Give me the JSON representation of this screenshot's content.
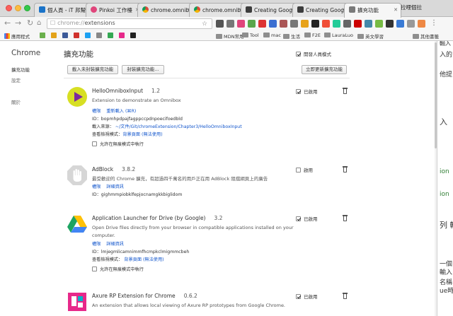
{
  "tabs": [
    {
      "label": "個人頁 - iT 邦幫",
      "favicon_color": "#1a73c8"
    },
    {
      "label": "Pinkoi 工作檯",
      "favicon_color": "#e0457b"
    },
    {
      "label": "chrome.omnibox",
      "favicon_color": "#dd4b39"
    },
    {
      "label": "chrome.omnibox",
      "favicon_color": "#dd4b39"
    },
    {
      "label": "Creating Goog",
      "favicon_color": "#3c3c3c"
    },
    {
      "label": "Creating Goog",
      "favicon_color": "#3c3c3c"
    },
    {
      "label": "擴充功能",
      "favicon_color": "#7a7a7a"
    }
  ],
  "right_tab_label": "拉哩個拉",
  "address": {
    "scheme": "chrome://",
    "path": "extensions"
  },
  "bookmarks": [
    {
      "label": "應用程式",
      "type": "apps"
    },
    {
      "label": "",
      "type": "icon",
      "color": "#6ab04c"
    },
    {
      "label": "",
      "type": "icon",
      "color": "#e3a21a"
    },
    {
      "label": "",
      "type": "icon",
      "color": "#3b5998"
    },
    {
      "label": "",
      "type": "icon",
      "color": "#d0312d"
    },
    {
      "label": "",
      "type": "icon",
      "color": "#1da1f2"
    },
    {
      "label": "",
      "type": "icon",
      "color": "#888888"
    },
    {
      "label": "",
      "type": "icon",
      "color": "#34a853"
    },
    {
      "label": "",
      "type": "icon",
      "color": "#e7298a"
    },
    {
      "label": "",
      "type": "icon",
      "color": "#222222"
    },
    {
      "label": "MDN常用",
      "type": "folder"
    },
    {
      "label": "Tool",
      "type": "folder"
    },
    {
      "label": "mac",
      "type": "folder"
    },
    {
      "label": "生活",
      "type": "folder"
    },
    {
      "label": "F2E",
      "type": "folder"
    },
    {
      "label": "LauraLuo",
      "type": "folder"
    },
    {
      "label": "英文學習",
      "type": "folder"
    },
    {
      "label": "其他書籤",
      "type": "folder"
    }
  ],
  "sidebar": {
    "title": "Chrome",
    "items": [
      {
        "label": "擴充功能",
        "selected": true
      },
      {
        "label": "設定",
        "selected": false
      },
      {
        "label": "關於",
        "selected": false
      }
    ]
  },
  "main": {
    "title": "擴充功能",
    "developer_mode_label": "開發人員模式",
    "developer_mode": true,
    "load_unpacked_label": "載入未封裝擴充功能",
    "pack_label": "封裝擴充功能...",
    "update_label": "立即更新擴充功能"
  },
  "labels": {
    "enabled": "已啟用",
    "enable": "啟用",
    "incognito": "允許在無痕模式中執行",
    "id_prefix": "ID：",
    "loaded_from": "載入來源：",
    "inspect_views": "查看檢視模式：",
    "permissions": "權限",
    "reload": "重新載入 (⌘R)",
    "details": "詳細資訊"
  },
  "extensions": [
    {
      "name": "HelloOmniboxInput",
      "version": "1.2",
      "description": "Extension to demonstrate an Omnibox",
      "id": "bopmhpdpajfagppccpdnpoecifoedbld",
      "loaded_from": "~/文件/Git/chromeExtension/Chapter3/HelloOmniboxInput",
      "inspect": "背景頁面 (無法使用)",
      "enabled": true,
      "show_reload": true,
      "logo": "play"
    },
    {
      "name": "AdBlock",
      "version": "3.8.2",
      "description": "最受歡迎的 Chrome 擴充，有超過四千萬名的用戶正在用 AdBlock 阻擋網頁上的廣告",
      "id": "gighmmpiobklfepjocnamgkkbiglidom",
      "enabled": false,
      "logo": "hand"
    },
    {
      "name": "Application Launcher for Drive (by Google)",
      "version": "3.2",
      "description": "Open Drive files directly from your browser in compatible applications installed on your computer.",
      "id": "lmjegmlicamnimmfhcmpkclmigmmcbeh",
      "inspect": "背景頁面 (無法使用)",
      "enabled": true,
      "logo": "drive"
    },
    {
      "name": "Axure RP Extension for Chrome",
      "version": "0.6.2",
      "description": "An extension that allows local viewing of Axure RP prototypes from Google Chrome.",
      "enabled": true,
      "logo": "axure"
    }
  ],
  "right_window_fragments": [
    "入的",
    "輸入",
    "他提",
    "入",
    "ion",
    "ion",
    "列 輸",
    "一個",
    "輸入",
    "名稱",
    "ue時"
  ]
}
